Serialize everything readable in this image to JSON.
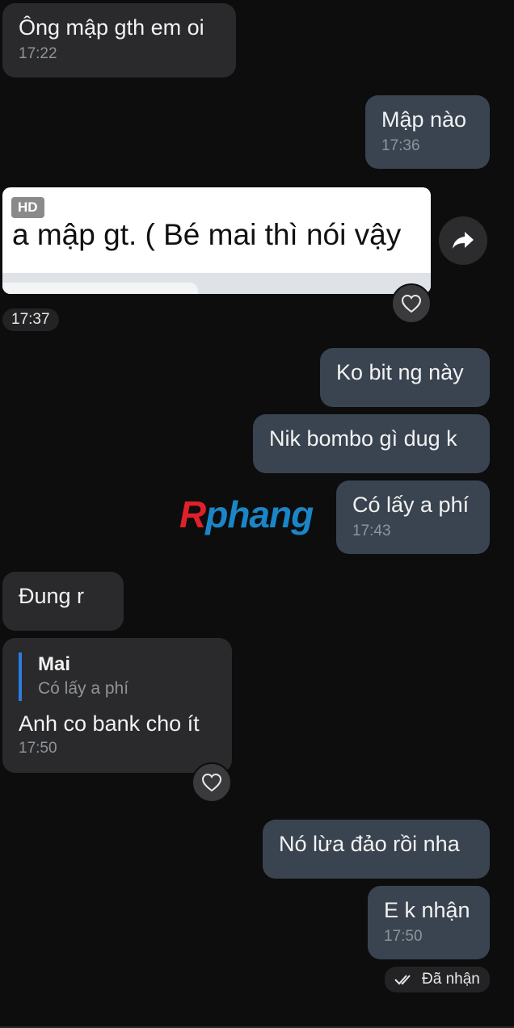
{
  "messages": {
    "m1": {
      "text": "Ông mập gth em oi",
      "time": "17:22"
    },
    "m2": {
      "text": "Mập nào",
      "time": "17:36"
    },
    "image": {
      "badge": "HD",
      "text": "a mập gt.  ( Bé mai thì nói vậy",
      "time": "17:37"
    },
    "m3": {
      "text": "Ko bit ng này"
    },
    "m4": {
      "text": "Nik bombo gì dug k"
    },
    "m5": {
      "text": "Có lấy a phí",
      "time": "17:43"
    },
    "m6": {
      "text": "Đung r"
    },
    "m7": {
      "reply_name": "Mai",
      "reply_text": "Có lấy a phí",
      "text": "Anh co bank cho ít",
      "time": "17:50"
    },
    "m8": {
      "text": "Nó lừa đảo rồi nha"
    },
    "m9": {
      "text": "E k nhận",
      "time": "17:50"
    }
  },
  "status": {
    "label": "Đã nhận"
  },
  "watermark": {
    "part1": "R",
    "part2": "phang"
  },
  "icons": {
    "heart": "heart-icon",
    "share": "share-icon",
    "check": "double-check-icon"
  },
  "colors": {
    "background": "#0d0d0e",
    "incoming": "#2a2a2c",
    "outgoing": "#3a4450",
    "reply_bar": "#2b7de0",
    "watermark_red": "#e0202a",
    "watermark_blue": "#1a86c8"
  }
}
